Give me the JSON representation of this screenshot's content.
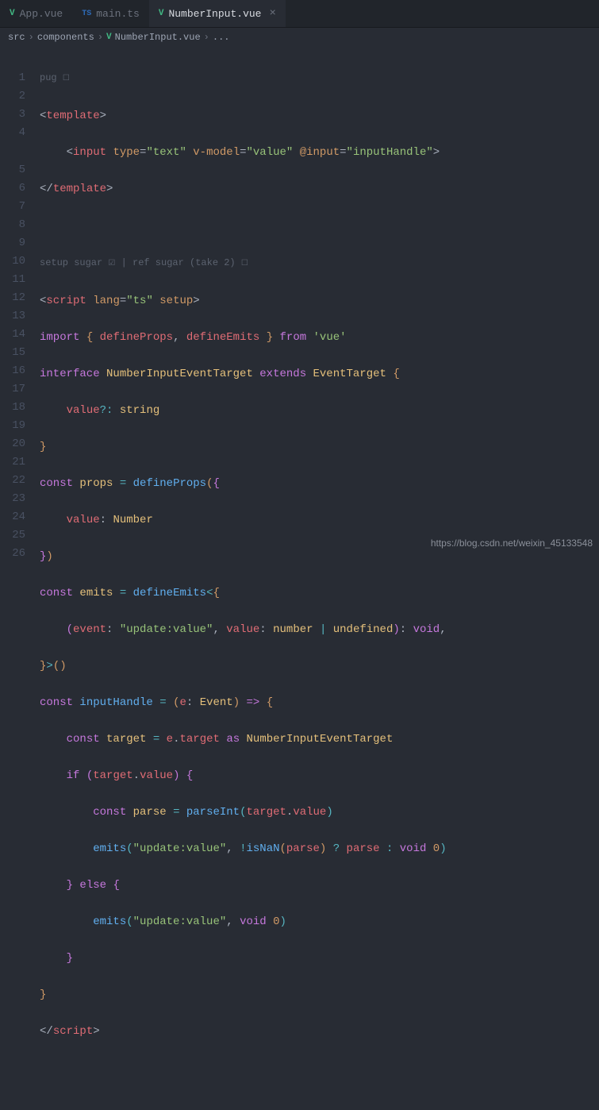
{
  "tabs": [
    {
      "icon": "V",
      "label": "App.vue",
      "active": false
    },
    {
      "icon": "TS",
      "label": "main.ts",
      "active": false
    },
    {
      "icon": "V",
      "label": "NumberInput.vue",
      "active": true
    }
  ],
  "breadcrumb": {
    "parts": [
      "src",
      "components",
      "NumberInput.vue",
      "..."
    ],
    "fileIcon": "V"
  },
  "hints": {
    "pug": "pug",
    "setup": "setup sugar",
    "ref": "ref sugar (take 2)"
  },
  "lineNumbers": [
    "1",
    "2",
    "3",
    "4",
    "5",
    "6",
    "7",
    "8",
    "9",
    "10",
    "11",
    "12",
    "13",
    "14",
    "15",
    "16",
    "17",
    "18",
    "19",
    "20",
    "21",
    "22",
    "23",
    "24",
    "25",
    "26"
  ],
  "code": {
    "l1": {
      "open": "<",
      "tag": "template",
      "close": ">"
    },
    "l2": {
      "open": "<",
      "tag": "input",
      "attr1": "type",
      "val1": "\"text\"",
      "attr2": "v-model",
      "val2": "\"value\"",
      "attr3": "@input",
      "val3": "\"inputHandle\"",
      "close": ">"
    },
    "l3": {
      "open": "</",
      "tag": "template",
      "close": ">"
    },
    "l5": {
      "open": "<",
      "tag": "script",
      "attr1": "lang",
      "val1": "\"ts\"",
      "attr2": "setup",
      "close": ">"
    },
    "l6": {
      "kw": "import",
      "b1": "{",
      "n1": "defineProps",
      "c": ",",
      "n2": "defineEmits",
      "b2": "}",
      "from": "from",
      "mod": "'vue'"
    },
    "l7": {
      "kw": "interface",
      "name": "NumberInputEventTarget",
      "ext": "extends",
      "base": "EventTarget",
      "b": "{"
    },
    "l8": {
      "prop": "value",
      "opt": "?:",
      "type": "string"
    },
    "l9": {
      "b": "}"
    },
    "l10": {
      "kw": "const",
      "name": "props",
      "eq": "=",
      "fn": "defineProps",
      "p1": "(",
      "b1": "{"
    },
    "l11": {
      "prop": "value",
      "col": ":",
      "type": "Number"
    },
    "l12": {
      "b1": "}",
      "p1": ")"
    },
    "l13": {
      "kw": "const",
      "name": "emits",
      "eq": "=",
      "fn": "defineEmits",
      "lt": "<",
      "b": "{"
    },
    "l14": {
      "p1": "(",
      "ev": "event",
      "col1": ":",
      "evn": "\"update:value\"",
      "c": ",",
      "val": "value",
      "col2": ":",
      "t1": "number",
      "pipe": "|",
      "t2": "undefined",
      "p2": ")",
      "col3": ":",
      "ret": "void",
      "c2": ","
    },
    "l15": {
      "b": "}",
      "gt": ">",
      "p1": "(",
      "p2": ")"
    },
    "l16": {
      "kw": "const",
      "name": "inputHandle",
      "eq": "=",
      "p1": "(",
      "arg": "e",
      "col": ":",
      "type": "Event",
      "p2": ")",
      "arrow": "=>",
      "b": "{"
    },
    "l17": {
      "kw": "const",
      "name": "target",
      "eq": "=",
      "obj": "e",
      "dot": ".",
      "prop": "target",
      "as": "as",
      "type": "NumberInputEventTarget"
    },
    "l18": {
      "kw": "if",
      "p1": "(",
      "obj": "target",
      "dot": ".",
      "prop": "value",
      "p2": ")",
      "b": "{"
    },
    "l19": {
      "kw": "const",
      "name": "parse",
      "eq": "=",
      "fn": "parseInt",
      "p1": "(",
      "obj": "target",
      "dot": ".",
      "prop": "value",
      "p2": ")"
    },
    "l20": {
      "fn": "emits",
      "p1": "(",
      "str": "\"update:value\"",
      "c": ",",
      "not": "!",
      "isnan": "isNaN",
      "p2": "(",
      "arg": "parse",
      "p3": ")",
      "q": "?",
      "v1": "parse",
      "col": ":",
      "void": "void",
      "zero": "0",
      "p4": ")"
    },
    "l21": {
      "b1": "}",
      "kw": "else",
      "b2": "{"
    },
    "l22": {
      "fn": "emits",
      "p1": "(",
      "str": "\"update:value\"",
      "c": ",",
      "void": "void",
      "zero": "0",
      "p2": ")"
    },
    "l23": {
      "b": "}"
    },
    "l24": {
      "b": "}"
    },
    "l25": {
      "open": "</",
      "tag": "script",
      "close": ">"
    }
  },
  "watermark": "https://blog.csdn.net/weixin_45133548"
}
